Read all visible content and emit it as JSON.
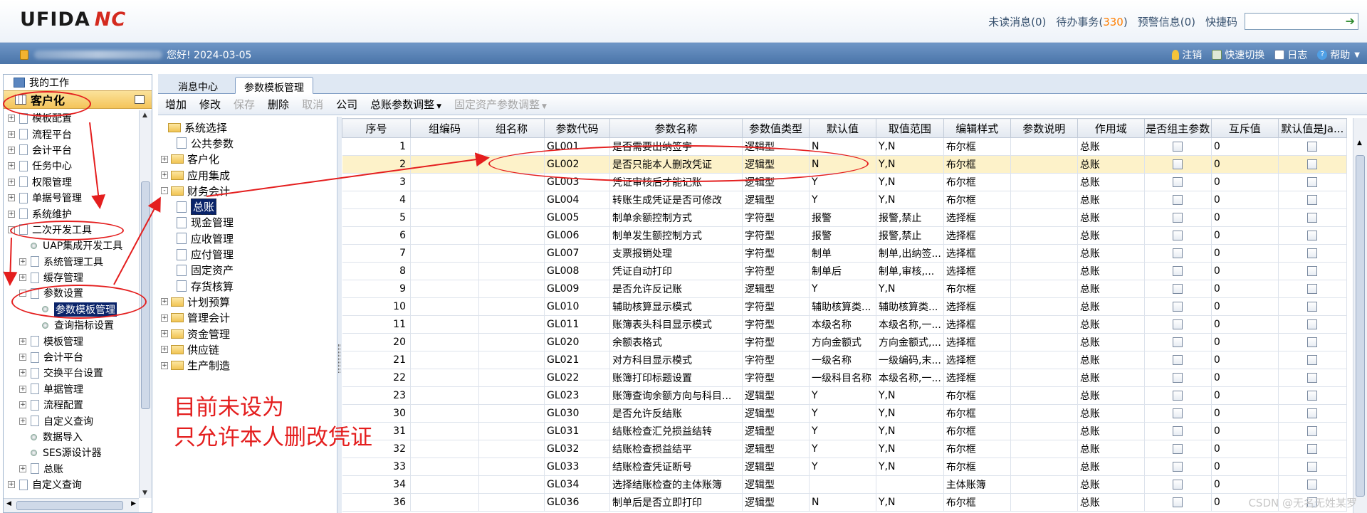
{
  "header": {
    "logo_text": "UFIDA",
    "logo_suffix": "NC",
    "links": [
      {
        "label": "未读消息",
        "count": "(0)"
      },
      {
        "label": "待办事务",
        "count": "330"
      },
      {
        "label": "预警信息",
        "count": "(0)"
      }
    ],
    "quick_code_label": "快捷码",
    "quick_code_value": ""
  },
  "bluebar": {
    "welcome_suffix": "您好! 2024-03-05",
    "actions": [
      "注销",
      "快速切换",
      "日志",
      "帮助"
    ]
  },
  "left_panel": {
    "my_work": "我的工作",
    "section": "客户化",
    "items": [
      {
        "label": "模板配置",
        "level": 0,
        "toggle": "+"
      },
      {
        "label": "流程平台",
        "level": 0,
        "toggle": "+"
      },
      {
        "label": "会计平台",
        "level": 0,
        "toggle": "+"
      },
      {
        "label": "任务中心",
        "level": 0,
        "toggle": "+"
      },
      {
        "label": "权限管理",
        "level": 0,
        "toggle": "+"
      },
      {
        "label": "单据号管理",
        "level": 0,
        "toggle": "+"
      },
      {
        "label": "系统维护",
        "level": 0,
        "toggle": "+"
      },
      {
        "label": "二次开发工具",
        "level": 0,
        "toggle": "-"
      },
      {
        "label": "UAP集成开发工具",
        "level": 1,
        "toggle": ""
      },
      {
        "label": "系统管理工具",
        "level": 1,
        "toggle": "+"
      },
      {
        "label": "缓存管理",
        "level": 1,
        "toggle": "+"
      },
      {
        "label": "参数设置",
        "level": 1,
        "toggle": "-"
      },
      {
        "label": "参数模板管理",
        "level": 2,
        "toggle": "",
        "selected": true
      },
      {
        "label": "查询指标设置",
        "level": 2,
        "toggle": ""
      },
      {
        "label": "模板管理",
        "level": 1,
        "toggle": "+"
      },
      {
        "label": "会计平台",
        "level": 1,
        "toggle": "+"
      },
      {
        "label": "交换平台设置",
        "level": 1,
        "toggle": "+"
      },
      {
        "label": "单据管理",
        "level": 1,
        "toggle": "+"
      },
      {
        "label": "流程配置",
        "level": 1,
        "toggle": "+"
      },
      {
        "label": "自定义查询",
        "level": 1,
        "toggle": "+"
      },
      {
        "label": "数据导入",
        "level": 1,
        "toggle": ""
      },
      {
        "label": "SES源设计器",
        "level": 1,
        "toggle": ""
      },
      {
        "label": "总账",
        "level": 1,
        "toggle": "+"
      },
      {
        "label": "自定义查询",
        "level": 0,
        "toggle": "+"
      }
    ]
  },
  "tabs": [
    {
      "label": "消息中心",
      "active": false
    },
    {
      "label": "参数模板管理",
      "active": true
    }
  ],
  "toolbar": {
    "buttons": [
      {
        "label": "增加",
        "enabled": true,
        "dropdown": false
      },
      {
        "label": "修改",
        "enabled": true,
        "dropdown": false
      },
      {
        "label": "保存",
        "enabled": false,
        "dropdown": false
      },
      {
        "label": "删除",
        "enabled": true,
        "dropdown": false
      },
      {
        "label": "取消",
        "enabled": false,
        "dropdown": false
      },
      {
        "label": "公司",
        "enabled": true,
        "dropdown": false
      },
      {
        "label": "总账参数调整",
        "enabled": true,
        "dropdown": true
      },
      {
        "label": "固定资产参数调整",
        "enabled": false,
        "dropdown": true
      }
    ]
  },
  "system_tree": {
    "root": "系统选择",
    "items": [
      {
        "label": "公共参数",
        "type": "page",
        "level": 1,
        "toggle": ""
      },
      {
        "label": "客户化",
        "type": "folder",
        "level": 0,
        "toggle": "+"
      },
      {
        "label": "应用集成",
        "type": "folder",
        "level": 0,
        "toggle": "+"
      },
      {
        "label": "财务会计",
        "type": "folder",
        "level": 0,
        "toggle": "-"
      },
      {
        "label": "总账",
        "type": "page",
        "level": 1,
        "toggle": "",
        "selected": true
      },
      {
        "label": "现金管理",
        "type": "page",
        "level": 1,
        "toggle": ""
      },
      {
        "label": "应收管理",
        "type": "page",
        "level": 1,
        "toggle": ""
      },
      {
        "label": "应付管理",
        "type": "page",
        "level": 1,
        "toggle": ""
      },
      {
        "label": "固定资产",
        "type": "page",
        "level": 1,
        "toggle": ""
      },
      {
        "label": "存货核算",
        "type": "page",
        "level": 1,
        "toggle": ""
      },
      {
        "label": "计划预算",
        "type": "folder",
        "level": 0,
        "toggle": "+"
      },
      {
        "label": "管理会计",
        "type": "folder",
        "level": 0,
        "toggle": "+"
      },
      {
        "label": "资金管理",
        "type": "folder",
        "level": 0,
        "toggle": "+"
      },
      {
        "label": "供应链",
        "type": "folder",
        "level": 0,
        "toggle": "+"
      },
      {
        "label": "生产制造",
        "type": "folder",
        "level": 0,
        "toggle": "+"
      }
    ]
  },
  "grid": {
    "columns": [
      "序号",
      "组编码",
      "组名称",
      "参数代码",
      "参数名称",
      "参数值类型",
      "默认值",
      "取值范围",
      "编辑样式",
      "参数说明",
      "作用域",
      "是否组主参数",
      "互斥值",
      "默认值是Ja..."
    ],
    "rows": [
      [
        "1",
        "",
        "",
        "GL001",
        "是否需要出纳签字",
        "逻辑型",
        "N",
        "Y,N",
        "布尔框",
        "",
        "总账",
        "",
        "0",
        ""
      ],
      [
        "2",
        "",
        "",
        "GL002",
        "是否只能本人删改凭证",
        "逻辑型",
        "N",
        "Y,N",
        "布尔框",
        "",
        "总账",
        "",
        "0",
        ""
      ],
      [
        "3",
        "",
        "",
        "GL003",
        "凭证审核后才能记账",
        "逻辑型",
        "Y",
        "Y,N",
        "布尔框",
        "",
        "总账",
        "",
        "0",
        ""
      ],
      [
        "4",
        "",
        "",
        "GL004",
        "转账生成凭证是否可修改",
        "逻辑型",
        "Y",
        "Y,N",
        "布尔框",
        "",
        "总账",
        "",
        "0",
        ""
      ],
      [
        "5",
        "",
        "",
        "GL005",
        "制单余额控制方式",
        "字符型",
        "报警",
        "报警,禁止",
        "选择框",
        "",
        "总账",
        "",
        "0",
        ""
      ],
      [
        "6",
        "",
        "",
        "GL006",
        "制单发生额控制方式",
        "字符型",
        "报警",
        "报警,禁止",
        "选择框",
        "",
        "总账",
        "",
        "0",
        ""
      ],
      [
        "7",
        "",
        "",
        "GL007",
        "支票报销处理",
        "字符型",
        "制单",
        "制单,出纳签...",
        "选择框",
        "",
        "总账",
        "",
        "0",
        ""
      ],
      [
        "8",
        "",
        "",
        "GL008",
        "凭证自动打印",
        "字符型",
        "制单后",
        "制单,审核,...",
        "选择框",
        "",
        "总账",
        "",
        "0",
        ""
      ],
      [
        "9",
        "",
        "",
        "GL009",
        "是否允许反记账",
        "逻辑型",
        "Y",
        "Y,N",
        "布尔框",
        "",
        "总账",
        "",
        "0",
        ""
      ],
      [
        "10",
        "",
        "",
        "GL010",
        "辅助核算显示模式",
        "字符型",
        "辅助核算类...",
        "辅助核算类...",
        "选择框",
        "",
        "总账",
        "",
        "0",
        ""
      ],
      [
        "11",
        "",
        "",
        "GL011",
        "账簿表头科目显示模式",
        "字符型",
        "本级名称",
        "本级名称,一...",
        "选择框",
        "",
        "总账",
        "",
        "0",
        ""
      ],
      [
        "20",
        "",
        "",
        "GL020",
        "余额表格式",
        "字符型",
        "方向金额式",
        "方向金额式,...",
        "选择框",
        "",
        "总账",
        "",
        "0",
        ""
      ],
      [
        "21",
        "",
        "",
        "GL021",
        "对方科目显示模式",
        "字符型",
        "一级名称",
        "一级编码,末...",
        "选择框",
        "",
        "总账",
        "",
        "0",
        ""
      ],
      [
        "22",
        "",
        "",
        "GL022",
        "账簿打印标题设置",
        "字符型",
        "一级科目名称",
        "本级名称,一...",
        "选择框",
        "",
        "总账",
        "",
        "0",
        ""
      ],
      [
        "23",
        "",
        "",
        "GL023",
        "账簿查询余额方向与科目...",
        "逻辑型",
        "Y",
        "Y,N",
        "布尔框",
        "",
        "总账",
        "",
        "0",
        ""
      ],
      [
        "30",
        "",
        "",
        "GL030",
        "是否允许反结账",
        "逻辑型",
        "Y",
        "Y,N",
        "布尔框",
        "",
        "总账",
        "",
        "0",
        ""
      ],
      [
        "31",
        "",
        "",
        "GL031",
        "结账检查汇兑损益结转",
        "逻辑型",
        "Y",
        "Y,N",
        "布尔框",
        "",
        "总账",
        "",
        "0",
        ""
      ],
      [
        "32",
        "",
        "",
        "GL032",
        "结账检查损益结平",
        "逻辑型",
        "Y",
        "Y,N",
        "布尔框",
        "",
        "总账",
        "",
        "0",
        ""
      ],
      [
        "33",
        "",
        "",
        "GL033",
        "结账检查凭证断号",
        "逻辑型",
        "Y",
        "Y,N",
        "布尔框",
        "",
        "总账",
        "",
        "0",
        ""
      ],
      [
        "34",
        "",
        "",
        "GL034",
        "选择结账检查的主体账簿",
        "逻辑型",
        "",
        "",
        "主体账簿",
        "",
        "总账",
        "",
        "0",
        ""
      ],
      [
        "36",
        "",
        "",
        "GL036",
        "制单后是否立即打印",
        "逻辑型",
        "N",
        "Y,N",
        "布尔框",
        "",
        "总账",
        "",
        "0",
        ""
      ]
    ],
    "highlighted_row": 1
  },
  "annotation": {
    "line1": "目前未设为",
    "line2": "只允许本人删改凭证"
  },
  "watermark": "CSDN @无名无姓某罗",
  "colors": {
    "annotation_red": "#e41e1e",
    "highlight_row": "#fdf2c9",
    "selection": "#0a246a",
    "pending_count": "#ff7e00"
  }
}
